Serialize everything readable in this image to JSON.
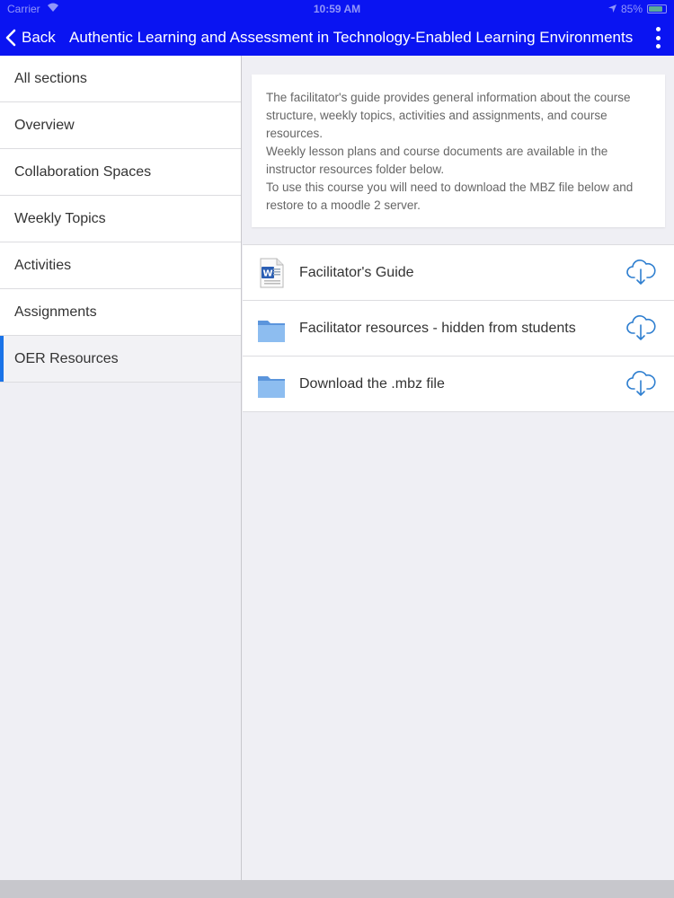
{
  "status": {
    "carrier": "Carrier",
    "time": "10:59 AM",
    "battery": "85%",
    "battery_level": 0.85
  },
  "nav": {
    "back_label": "Back",
    "title": "Authentic Learning and Assessment in Technology-Enabled Learning Environments"
  },
  "sidebar": {
    "items": [
      {
        "label": "All sections"
      },
      {
        "label": "Overview"
      },
      {
        "label": "Collaboration Spaces"
      },
      {
        "label": "Weekly Topics"
      },
      {
        "label": "Activities"
      },
      {
        "label": "Assignments"
      },
      {
        "label": "OER Resources"
      }
    ],
    "active_index": 6
  },
  "summary": {
    "paragraphs": [
      "The facilitator's guide provides general information about the course structure, weekly topics, activities and assignments, and course resources.",
      "Weekly lesson plans and course documents are available in the instructor resources folder below.",
      "To use this course you will need to download the MBZ file below and restore to a moodle 2 server."
    ]
  },
  "resources": [
    {
      "label": "Facilitator's Guide",
      "icon": "word-document-icon"
    },
    {
      "label": "Facilitator resources - hidden from students",
      "icon": "folder-icon"
    },
    {
      "label": "Download the .mbz file",
      "icon": "folder-icon"
    }
  ],
  "colors": {
    "nav_bar": "#0a14f2",
    "active_accent": "#1a73e8",
    "download_icon": "#2f7fd0",
    "folder": "#6fa8e6"
  }
}
